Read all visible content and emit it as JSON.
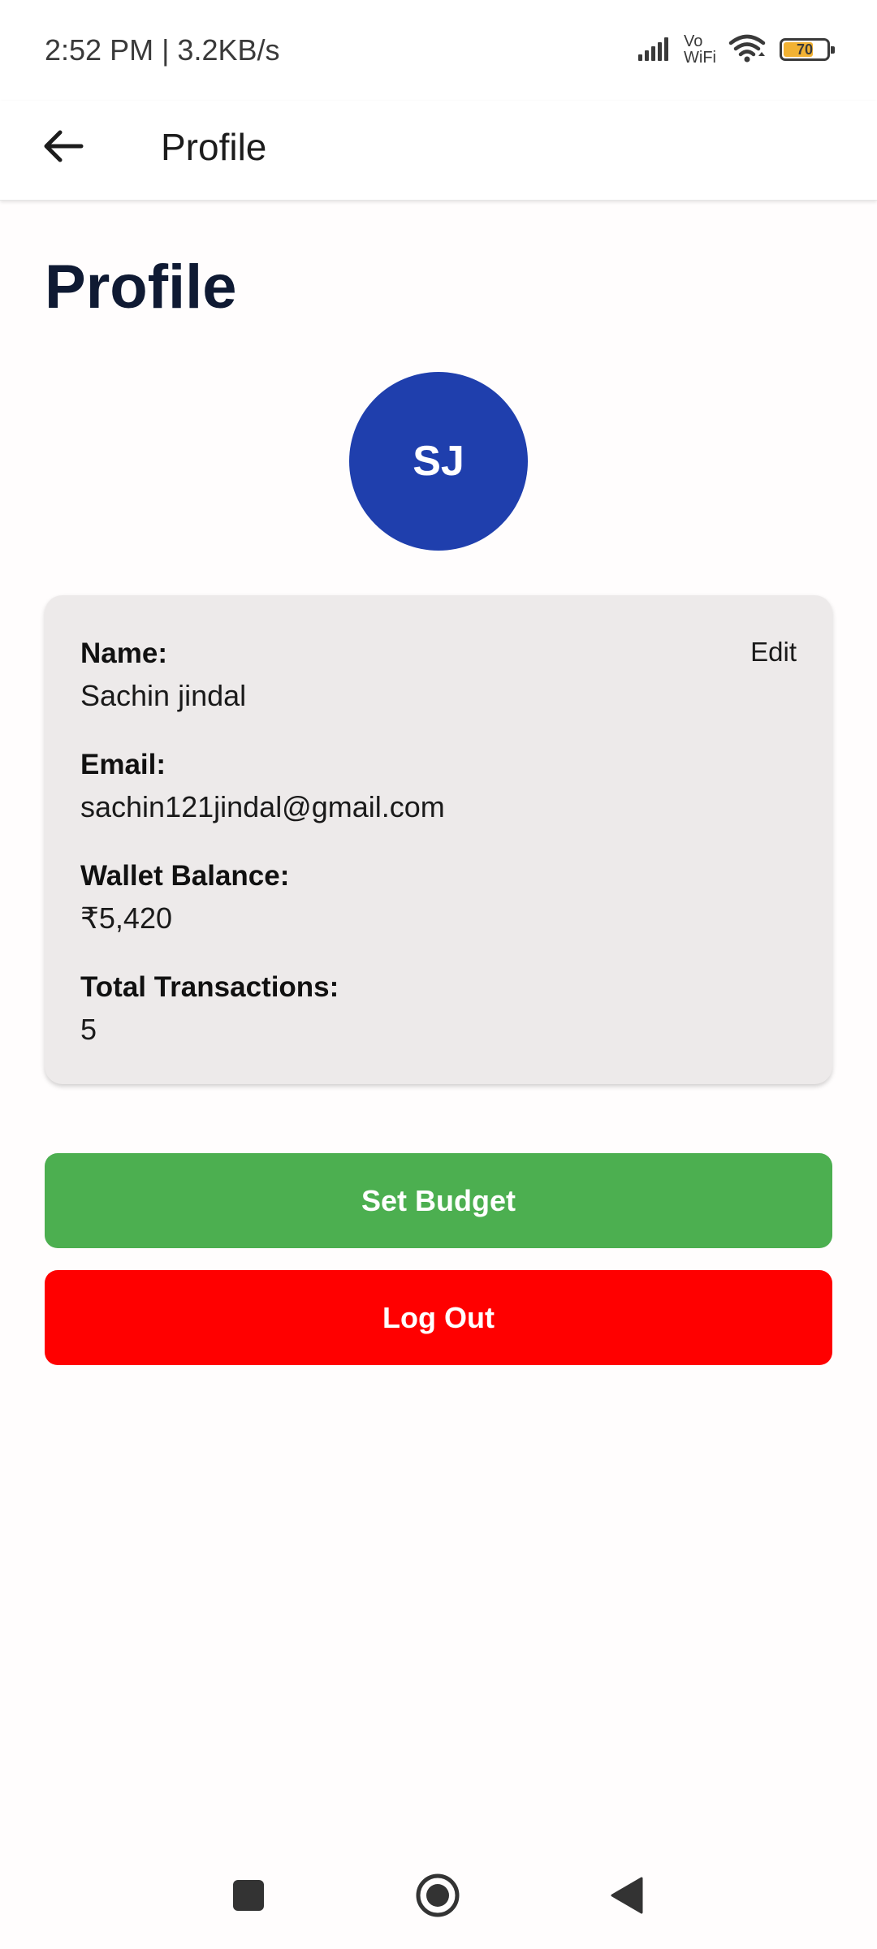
{
  "status_bar": {
    "time_text": "2:52 PM | 3.2KB/s",
    "vowifi_top": "Vo",
    "vowifi_bottom": "WiFi",
    "battery_level": 70,
    "battery_text": "70",
    "icons": [
      "signal-icon",
      "vowifi-icon",
      "wifi-icon",
      "battery-icon"
    ]
  },
  "app_bar": {
    "title": "Profile",
    "back_icon": "arrow-left-icon"
  },
  "page": {
    "heading": "Profile"
  },
  "avatar": {
    "initials": "SJ",
    "color": "#1f3fad"
  },
  "profile_card": {
    "edit_label": "Edit",
    "fields": [
      {
        "label": "Name:",
        "value": "Sachin jindal"
      },
      {
        "label": "Email:",
        "value": "sachin121jindal@gmail.com"
      },
      {
        "label": "Wallet Balance:",
        "value": "₹5,420"
      },
      {
        "label": "Total Transactions:",
        "value": "5"
      }
    ]
  },
  "actions": {
    "set_budget_label": "Set Budget",
    "set_budget_color": "#4caf50",
    "logout_label": "Log Out",
    "logout_color": "#ff0000"
  },
  "nav_bar": {
    "icons": [
      "recents-square-icon",
      "home-circle-icon",
      "back-triangle-icon"
    ]
  }
}
